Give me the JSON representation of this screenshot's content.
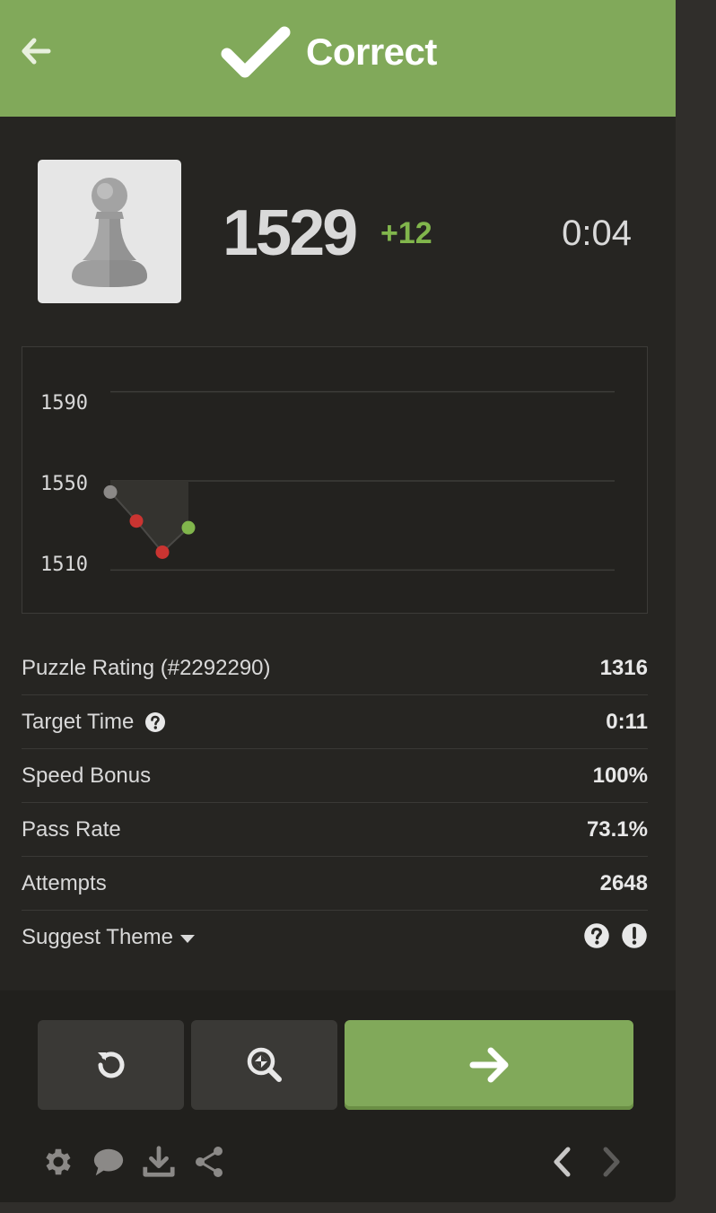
{
  "header": {
    "title": "Correct",
    "color": "#81a95a"
  },
  "player": {
    "avatar_icon": "pawn-icon",
    "rating": "1529",
    "rating_change": "+12",
    "time": "0:04"
  },
  "chart_data": {
    "type": "line",
    "x": [
      1,
      2,
      3,
      4
    ],
    "values": [
      1545,
      1532,
      1518,
      1529
    ],
    "point_colors": [
      "#8b8987",
      "#ca3431",
      "#ca3431",
      "#81b64c"
    ],
    "y_ticks": [
      "1590",
      "1550",
      "1510"
    ],
    "ylim": [
      1490,
      1610
    ],
    "baseline": 1550,
    "grid": true
  },
  "stats": [
    {
      "label": "Puzzle Rating (#2292290)",
      "value": "1316"
    },
    {
      "label": "Target Time",
      "value": "0:11"
    },
    {
      "label": "Speed Bonus",
      "value": "100%"
    },
    {
      "label": "Pass Rate",
      "value": "73.1%"
    },
    {
      "label": "Attempts",
      "value": "2648"
    }
  ],
  "suggest_theme": {
    "label": "Suggest Theme"
  },
  "buttons": {
    "retry_icon": "retry-icon",
    "analysis_icon": "analysis-icon",
    "next_icon": "arrow-right-icon"
  },
  "toolbar": [
    "gear-icon",
    "chat-icon",
    "download-icon",
    "share-icon"
  ],
  "nav": [
    "chevron-left-icon",
    "chevron-right-icon"
  ]
}
